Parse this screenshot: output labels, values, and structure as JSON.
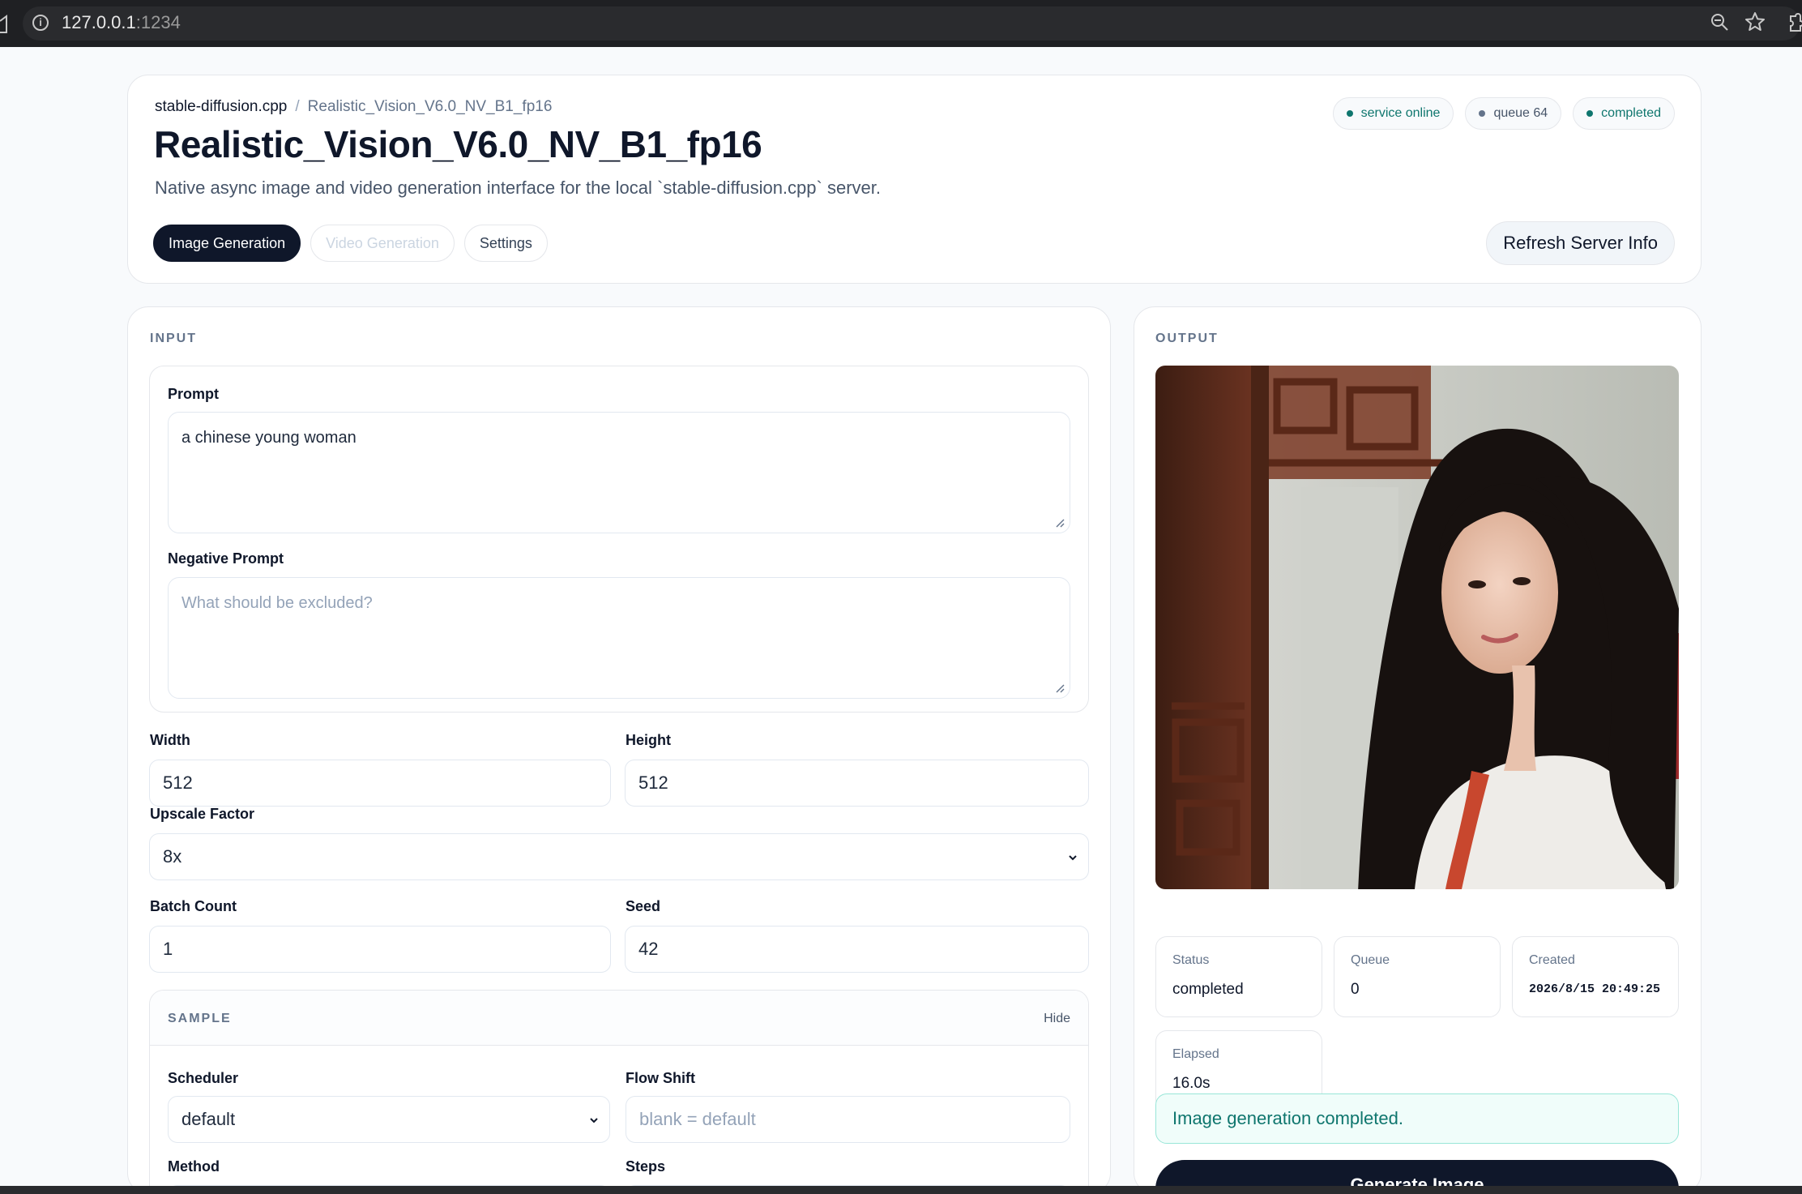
{
  "browser": {
    "url_host": "127.0.0.1",
    "url_port": ":1234"
  },
  "header": {
    "breadcrumb_root": "stable-diffusion.cpp",
    "breadcrumb_sep": "/",
    "breadcrumb_current": "Realistic_Vision_V6.0_NV_B1_fp16",
    "title": "Realistic_Vision_V6.0_NV_B1_fp16",
    "subtitle": "Native async image and video generation interface for the local `stable-diffusion.cpp` server.",
    "badges": [
      "service online",
      "queue 64",
      "completed"
    ],
    "tabs": [
      "Image Generation",
      "Video Generation",
      "Settings"
    ],
    "refresh_label": "Refresh Server Info"
  },
  "input": {
    "section_label": "INPUT",
    "prompt_label": "Prompt",
    "prompt_value": "a chinese young woman",
    "negative_label": "Negative Prompt",
    "negative_placeholder": "What should be excluded?",
    "width_label": "Width",
    "width_value": "512",
    "height_label": "Height",
    "height_value": "512",
    "upscale_label": "Upscale Factor",
    "upscale_value": "8x",
    "batch_label": "Batch Count",
    "batch_value": "1",
    "seed_label": "Seed",
    "seed_value": "42",
    "sample": {
      "section_label": "SAMPLE",
      "hide_label": "Hide",
      "scheduler_label": "Scheduler",
      "scheduler_value": "default",
      "flow_shift_label": "Flow Shift",
      "flow_shift_placeholder": "blank = default",
      "method_label": "Method",
      "steps_label": "Steps"
    }
  },
  "output": {
    "section_label": "OUTPUT",
    "status_label": "Status",
    "status_value": "completed",
    "queue_label": "Queue",
    "queue_value": "0",
    "created_label": "Created",
    "created_value": "2026/8/15 20:49:25",
    "elapsed_label": "Elapsed",
    "elapsed_value": "16.0s",
    "message": "Image generation completed.",
    "generate_label": "Generate Image"
  },
  "colors": {
    "primary": "#0f172a",
    "accent_green": "#0f766e",
    "success_bg": "#f0fdfa"
  }
}
